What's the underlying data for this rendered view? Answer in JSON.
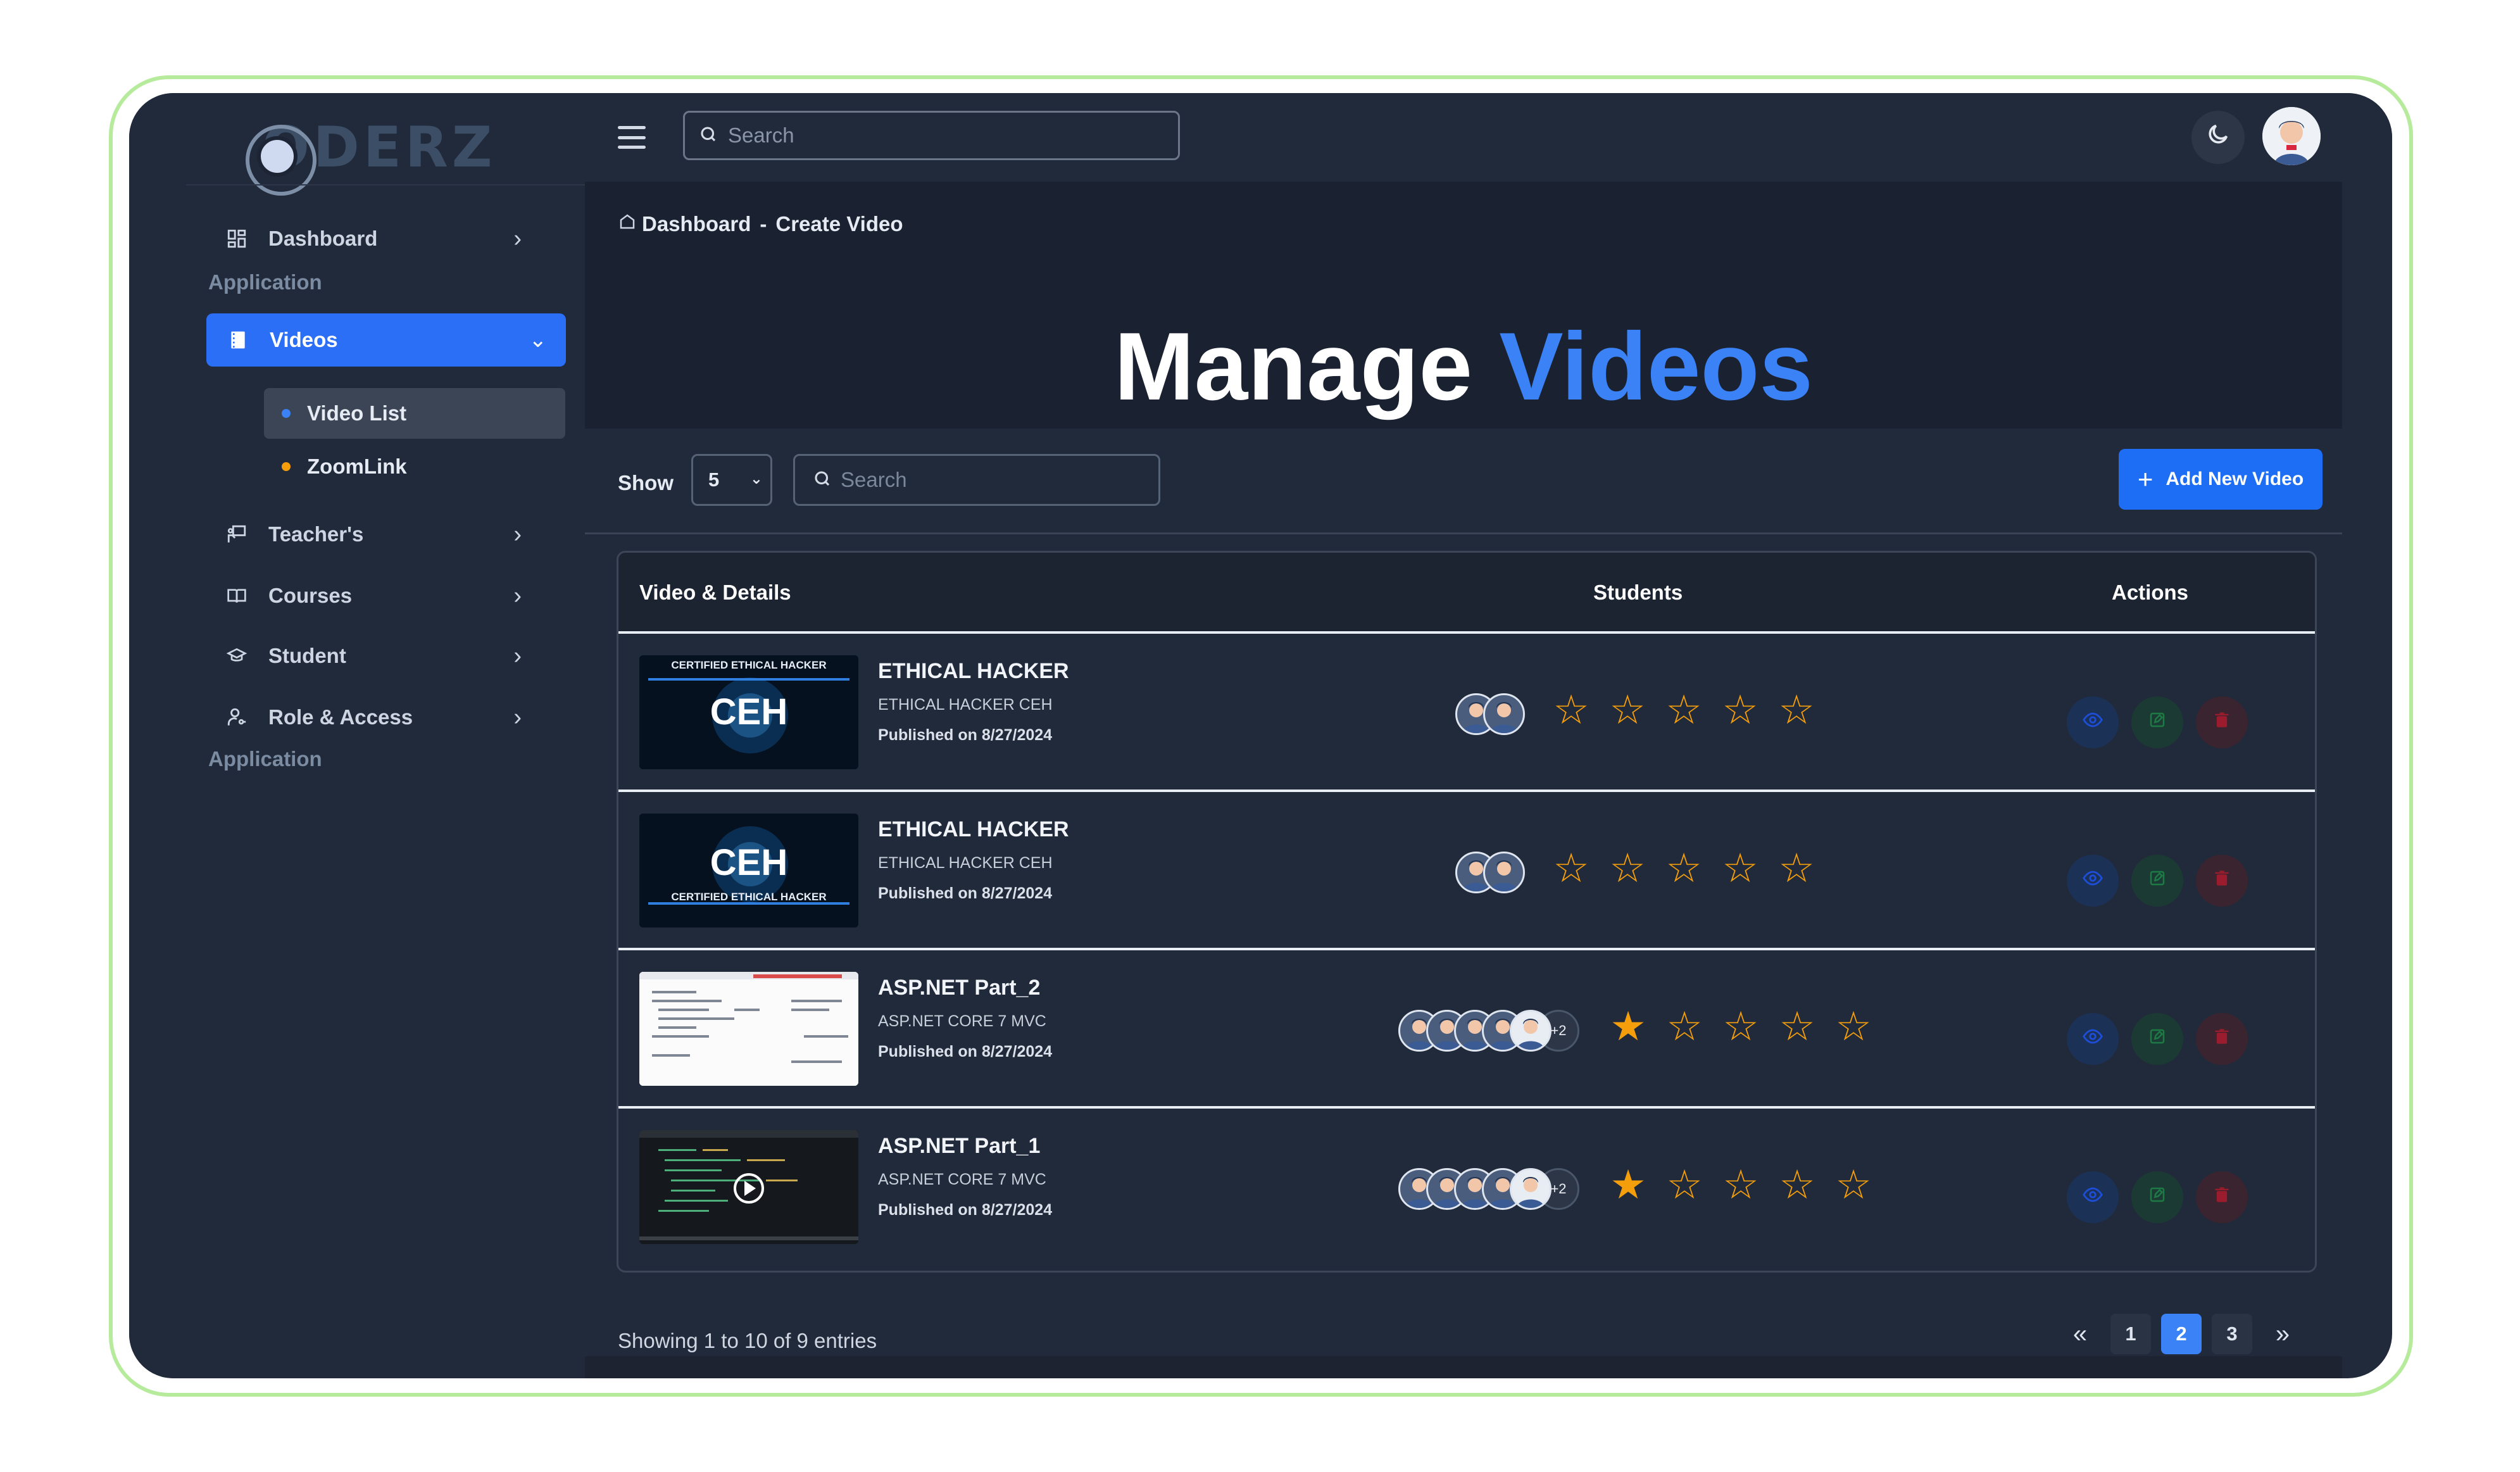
{
  "brand": {
    "logo_text": "ODERZ"
  },
  "topbar": {
    "search_placeholder": "Search"
  },
  "sidebar": {
    "items": [
      {
        "label": "Dashboard"
      },
      {
        "label": "Videos"
      },
      {
        "label": "Teacher's"
      },
      {
        "label": "Courses"
      },
      {
        "label": "Student"
      },
      {
        "label": "Role & Access"
      }
    ],
    "sections": [
      "Application",
      "Application"
    ],
    "subitems": [
      {
        "label": "Video List",
        "dot_color": "#3b82f6"
      },
      {
        "label": "ZoomLink",
        "dot_color": "#f59e0b"
      }
    ]
  },
  "breadcrumb": {
    "home": "Dashboard",
    "sep": "-",
    "current": "Create Video"
  },
  "page": {
    "title_part1": "Manage",
    "title_part2": "Videos"
  },
  "toolbar": {
    "show_label": "Show",
    "show_value": "5",
    "search_placeholder": "Search",
    "add_label": "Add New Video"
  },
  "table": {
    "headers": [
      "Video & Details",
      "Students",
      "Actions"
    ],
    "rows": [
      {
        "title": "ETHICAL HACKER",
        "subtitle": "ETHICAL HACKER CEH",
        "published": "Published on 8/27/2024",
        "students": 2,
        "extra": "",
        "rating": 0
      },
      {
        "title": "ETHICAL HACKER",
        "subtitle": "ETHICAL HACKER CEH",
        "published": "Published on 8/27/2024",
        "students": 2,
        "extra": "",
        "rating": 0
      },
      {
        "title": "ASP.NET Part_2",
        "subtitle": "ASP.NET CORE 7 MVC",
        "published": "Published on 8/27/2024",
        "students": 5,
        "extra": "+2",
        "rating": 1
      },
      {
        "title": "ASP.NET Part_1",
        "subtitle": "ASP.NET CORE 7 MVC",
        "published": "Published on 8/27/2024",
        "students": 5,
        "extra": "+2",
        "rating": 1
      }
    ],
    "thumb_text": {
      "cert": "CERTIFIED ETHICAL HACKER",
      "ceh": "CEH"
    }
  },
  "footer": {
    "info": "Showing 1 to 10 of 9 entries",
    "pages": [
      "1",
      "2",
      "3"
    ],
    "active_page": "2"
  },
  "colors": {
    "accent": "#3b82f6",
    "primary_button": "#1d6ef5",
    "star": "#f59e0b",
    "frame": "#b6eb9c"
  }
}
